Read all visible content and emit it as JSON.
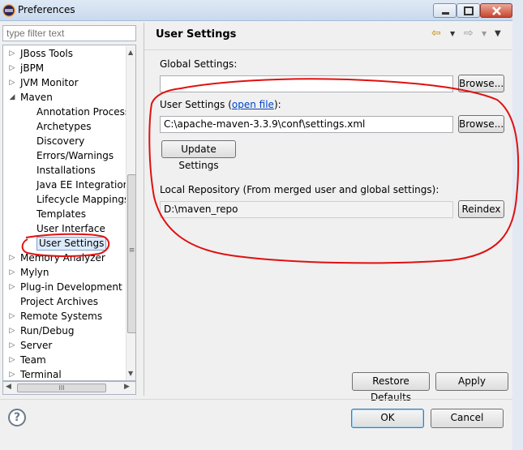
{
  "window": {
    "title": "Preferences"
  },
  "filter": {
    "placeholder": "type filter text"
  },
  "tree": {
    "items": [
      {
        "label": "JBoss Tools",
        "expandable": true,
        "level": 0
      },
      {
        "label": "jBPM",
        "expandable": true,
        "level": 0
      },
      {
        "label": "JVM Monitor",
        "expandable": true,
        "level": 0
      },
      {
        "label": "Maven",
        "expandable": true,
        "expanded": true,
        "level": 0
      },
      {
        "label": "Annotation Processi",
        "level": 1
      },
      {
        "label": "Archetypes",
        "level": 1
      },
      {
        "label": "Discovery",
        "level": 1
      },
      {
        "label": "Errors/Warnings",
        "level": 1
      },
      {
        "label": "Installations",
        "level": 1
      },
      {
        "label": "Java EE Integration",
        "level": 1
      },
      {
        "label": "Lifecycle Mappings",
        "level": 1
      },
      {
        "label": "Templates",
        "level": 1
      },
      {
        "label": "User Interface",
        "level": 1
      },
      {
        "label": "User Settings",
        "level": 1,
        "selected": true
      },
      {
        "label": "Memory Analyzer",
        "expandable": true,
        "level": 0
      },
      {
        "label": "Mylyn",
        "expandable": true,
        "level": 0
      },
      {
        "label": "Plug-in Development",
        "expandable": true,
        "level": 0
      },
      {
        "label": "Project Archives",
        "level": 0
      },
      {
        "label": "Remote Systems",
        "expandable": true,
        "level": 0
      },
      {
        "label": "Run/Debug",
        "expandable": true,
        "level": 0
      },
      {
        "label": "Server",
        "expandable": true,
        "level": 0
      },
      {
        "label": "Team",
        "expandable": true,
        "level": 0
      },
      {
        "label": "Terminal",
        "expandable": true,
        "level": 0
      }
    ]
  },
  "page": {
    "title": "User Settings",
    "global_settings": {
      "label": "Global Settings:",
      "value": "",
      "browse_label": "Browse..."
    },
    "user_settings": {
      "label_prefix": "User Settings (",
      "link_text": "open file",
      "label_suffix": "):",
      "value": "C:\\apache-maven-3.3.9\\conf\\settings.xml",
      "browse_label": "Browse...",
      "update_label": "Update Settings"
    },
    "local_repository": {
      "label": "Local Repository (From merged user and global settings):",
      "value": "D:\\maven_repo",
      "reindex_label": "Reindex"
    },
    "restore_defaults_label": "Restore Defaults",
    "apply_label": "Apply"
  },
  "footer": {
    "ok_label": "OK",
    "cancel_label": "Cancel"
  },
  "colors": {
    "annotation": "#e01010",
    "link": "#0044cc"
  },
  "icons": {
    "back": "arrow-left-icon",
    "forward": "arrow-right-icon",
    "help": "help-icon"
  }
}
